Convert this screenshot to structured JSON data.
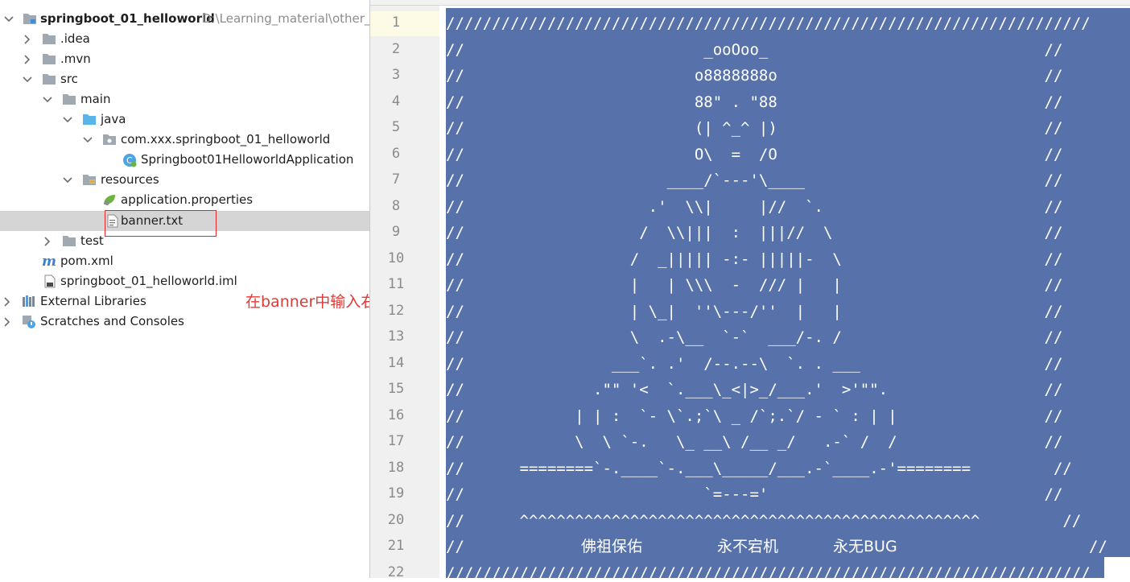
{
  "project_tree": {
    "root": {
      "label": "springboot_01_helloworld",
      "path": "D:\\Learning_material\\other_"
    },
    "idea": ".idea",
    "mvn": ".mvn",
    "src": "src",
    "main": "main",
    "java": "java",
    "package": "com.xxx.springboot_01_helloworld",
    "app_class": "Springboot01HelloworldApplication",
    "resources": "resources",
    "app_props": "application.properties",
    "banner": "banner.txt",
    "test": "test",
    "pom": "pom.xml",
    "iml": "springboot_01_helloworld.iml",
    "ext_libs": "External Libraries",
    "scratches": "Scratches and Consoles"
  },
  "annotation": "在banner中输入右侧字符",
  "editor": {
    "line_numbers": [
      "1",
      "2",
      "3",
      "4",
      "5",
      "6",
      "7",
      "8",
      "9",
      "10",
      "11",
      "12",
      "13",
      "14",
      "15",
      "16",
      "17",
      "18",
      "19",
      "20",
      "21",
      "22"
    ],
    "lines": [
      "//////////////////////////////////////////////////////////////////////",
      "//                          _ooOoo_                              //",
      "//                         o8888888o                             //",
      "//                         88\" . \"88                             //",
      "//                         (| ^_^ |)                             //",
      "//                         O\\  =  /O                             //",
      "//                      ____/`---'\\____                          //",
      "//                    .'  \\\\|     |//  `.                        //",
      "//                   /  \\\\|||  :  |||//  \\                       //",
      "//                  /  _||||| -:- |||||-  \\                      //",
      "//                  |   | \\\\\\  -  /// |   |                      //",
      "//                  | \\_|  ''\\---/''  |   |                      //",
      "//                  \\  .-\\__  `-`  ___/-. /                      //",
      "//                ___`. .'  /--.--\\  `. . ___                    //",
      "//              .\"\" '<  `.___\\_<|>_/___.'  >'\"\".                 //",
      "//            | | :  `- \\`.;`\\ _ /`;.`/ - ` : | |                //",
      "//            \\  \\ `-.   \\_ __\\ /__ _/   .-` /  /                //",
      "//      ========`-.____`-.___\\_____/___.-`____.-'========         //",
      "//                          `=---='                              //",
      "//      ^^^^^^^^^^^^^^^^^^^^^^^^^^^^^^^^^^^^^^^^^^^^^^^^^^         //",
      "//",
      "//////////////////////////////////////////////////////////////////////"
    ],
    "line21_cn": [
      "佛祖保佑",
      "永不宕机",
      "永无BUG"
    ],
    "line21_end": "//"
  }
}
